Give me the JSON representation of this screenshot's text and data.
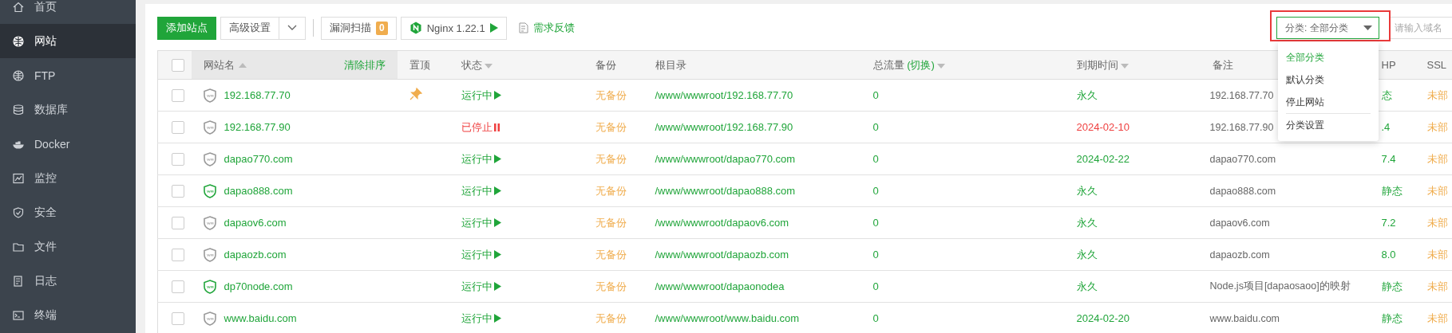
{
  "sidebar": {
    "items": [
      {
        "label": "首页",
        "selected": false
      },
      {
        "label": "网站",
        "selected": true
      },
      {
        "label": "FTP",
        "selected": false
      },
      {
        "label": "数据库",
        "selected": false
      },
      {
        "label": "Docker",
        "selected": false
      },
      {
        "label": "监控",
        "selected": false
      },
      {
        "label": "安全",
        "selected": false
      },
      {
        "label": "文件",
        "selected": false
      },
      {
        "label": "日志",
        "selected": false
      },
      {
        "label": "终端",
        "selected": false
      }
    ]
  },
  "toolbar": {
    "add_button": "添加站点",
    "advanced_button": "高级设置",
    "scan_button": "漏洞扫描",
    "scan_count": "0",
    "nginx_button": "Nginx 1.22.1",
    "feedback_link": "需求反馈",
    "category_select": "分类: 全部分类",
    "search": {
      "placeholder": "请输入域名"
    }
  },
  "category_menu": {
    "items": [
      {
        "label": "全部分类",
        "selected": true
      },
      {
        "label": "默认分类",
        "selected": false
      },
      {
        "label": "停止网站",
        "selected": false
      },
      {
        "label": "分类设置",
        "selected": false
      }
    ]
  },
  "table": {
    "select_all_checked": false,
    "columns": {
      "name": "网站名",
      "clear_sort": "清除排序",
      "pin": "置顶",
      "status": "状态",
      "backup": "备份",
      "root": "根目录",
      "traffic": "总流量",
      "traffic_toggle": "(切换)",
      "expiry": "到期时间",
      "note": "备注",
      "php": "HP",
      "ssl": "SSL"
    },
    "rows": [
      {
        "checked": false,
        "name": "192.168.77.70",
        "waf": false,
        "pinned": true,
        "running": true,
        "status": "运行中",
        "backup": "无备份",
        "root": "/www/wwwroot/192.168.77.70",
        "traffic": "0",
        "expiry": "永久",
        "expired": false,
        "note": "192.168.77.70",
        "php": "态",
        "ssl": "未部"
      },
      {
        "checked": false,
        "name": "192.168.77.90",
        "waf": false,
        "pinned": false,
        "running": false,
        "status": "已停止",
        "backup": "无备份",
        "root": "/www/wwwroot/192.168.77.90",
        "traffic": "0",
        "expiry": "2024-02-10",
        "expired": true,
        "note": "192.168.77.90",
        "php": ".4",
        "ssl": "未部"
      },
      {
        "checked": false,
        "name": "dapao770.com",
        "waf": false,
        "pinned": false,
        "running": true,
        "status": "运行中",
        "backup": "无备份",
        "root": "/www/wwwroot/dapao770.com",
        "traffic": "0",
        "expiry": "2024-02-22",
        "expired": false,
        "note": "dapao770.com",
        "php": "7.4",
        "ssl": "未部"
      },
      {
        "checked": false,
        "name": "dapao888.com",
        "waf": true,
        "pinned": false,
        "running": true,
        "status": "运行中",
        "backup": "无备份",
        "root": "/www/wwwroot/dapao888.com",
        "traffic": "0",
        "expiry": "永久",
        "expired": false,
        "note": "dapao888.com",
        "php": "静态",
        "ssl": "未部"
      },
      {
        "checked": false,
        "name": "dapaov6.com",
        "waf": false,
        "pinned": false,
        "running": true,
        "status": "运行中",
        "backup": "无备份",
        "root": "/www/wwwroot/dapaov6.com",
        "traffic": "0",
        "expiry": "永久",
        "expired": false,
        "note": "dapaov6.com",
        "php": "7.2",
        "ssl": "未部"
      },
      {
        "checked": false,
        "name": "dapaozb.com",
        "waf": false,
        "pinned": false,
        "running": true,
        "status": "运行中",
        "backup": "无备份",
        "root": "/www/wwwroot/dapaozb.com",
        "traffic": "0",
        "expiry": "永久",
        "expired": false,
        "note": "dapaozb.com",
        "php": "8.0",
        "ssl": "未部"
      },
      {
        "checked": false,
        "name": "dp70node.com",
        "waf": true,
        "pinned": false,
        "running": true,
        "status": "运行中",
        "backup": "无备份",
        "root": "/www/wwwroot/dapaonodea",
        "traffic": "0",
        "expiry": "永久",
        "expired": false,
        "note": "Node.js项目[dapaosaoo]的映射",
        "php": "静态",
        "ssl": "未部"
      },
      {
        "checked": false,
        "name": "www.baidu.com",
        "waf": false,
        "pinned": false,
        "running": true,
        "status": "运行中",
        "backup": "无备份",
        "root": "/www/wwwroot/www.baidu.com",
        "traffic": "0",
        "expiry": "2024-02-20",
        "expired": false,
        "note": "www.baidu.com",
        "php": "静态",
        "ssl": "未部"
      }
    ]
  }
}
